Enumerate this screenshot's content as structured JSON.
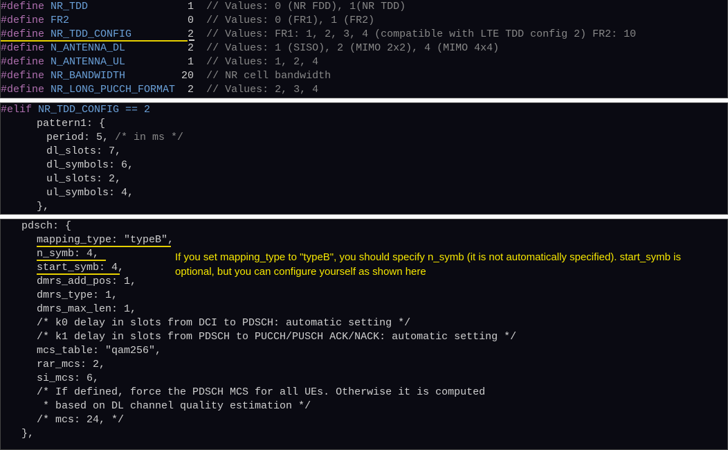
{
  "defines": [
    {
      "name": "NR_TDD",
      "val": "1",
      "comment": "// Values: 0 (NR FDD), 1(NR TDD)"
    },
    {
      "name": "FR2",
      "val": "0",
      "comment": "// Values: 0 (FR1), 1 (FR2)"
    },
    {
      "name": "NR_TDD_CONFIG",
      "val": "2",
      "comment": "// Values: FR1: 1, 2, 3, 4 (compatible with LTE TDD config 2) FR2: 10"
    },
    {
      "name": "N_ANTENNA_DL",
      "val": "2",
      "comment": "// Values: 1 (SISO), 2 (MIMO 2x2), 4 (MIMO 4x4)"
    },
    {
      "name": "N_ANTENNA_UL",
      "val": "1",
      "comment": "// Values: 1, 2, 4"
    },
    {
      "name": "NR_BANDWIDTH",
      "val": "20",
      "comment": "// NR cell bandwidth"
    },
    {
      "name": "NR_LONG_PUCCH_FORMAT",
      "val": "2",
      "comment": "// Values: 2, 3, 4"
    }
  ],
  "block2": {
    "elif_kw": "#elif",
    "elif_rest": " NR_TDD_CONFIG == 2",
    "l1": "pattern1: {",
    "l2": "period: 5, ",
    "l2c": "/* in ms */",
    "l3": "dl_slots: 7,",
    "l4": "dl_symbols: 6,",
    "l5": "ul_slots: 2,",
    "l6": "ul_symbols: 4,",
    "l7": "},"
  },
  "block3": {
    "l0": "pdsch: {",
    "l1": "mapping_type: \"typeB\",",
    "l2": "n_symb: 4,",
    "l3": "start_symb: 4,",
    "l4": "dmrs_add_pos: 1,",
    "l5": "dmrs_type: 1,",
    "l6": "dmrs_max_len: 1,",
    "c1": "/* k0 delay in slots from DCI to PDSCH: automatic setting */",
    "c2": "/* k1 delay in slots from PDSCH to PUCCH/PUSCH ACK/NACK: automatic setting */",
    "l7": "mcs_table: \"qam256\",",
    "l8": "rar_mcs: 2,",
    "l9": "si_mcs: 6,",
    "c3a": "/* If defined, force the PDSCH MCS for all UEs. Otherwise it is computed",
    "c3b": " * based on DL channel quality estimation */",
    "c4": "/* mcs: 24, */",
    "l10": "},"
  },
  "annotation": "If you set mapping_type to \"typeB\", you should specify n_symb (it is not automatically specified). start_symb is optional, but you can configure yourself as shown here"
}
